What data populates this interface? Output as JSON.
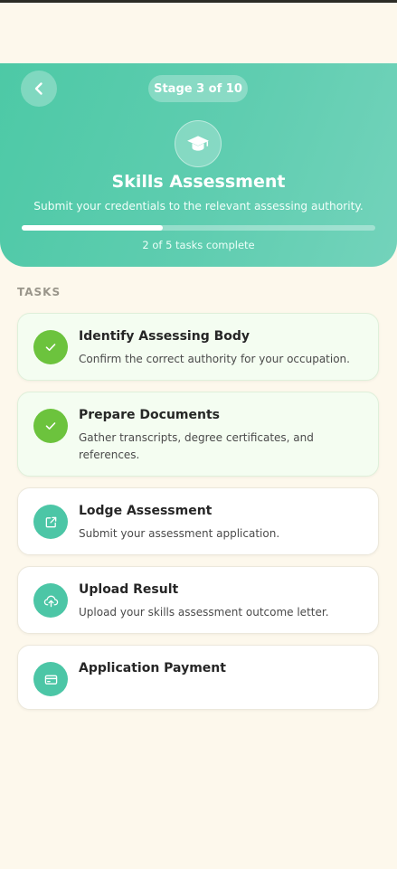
{
  "header": {
    "stage_label": "Stage 3 of 10",
    "title": "Skills Assessment",
    "subtitle": "Submit your credentials to the relevant assessing authority.",
    "progress_text": "2 of 5 tasks complete",
    "progress_fraction": 0.4,
    "icon": "graduation-cap-icon"
  },
  "tasks_section": {
    "label": "TASKS",
    "items": [
      {
        "title": "Identify Assessing Body",
        "description": "Confirm the correct authority for your occupation.",
        "status": "complete",
        "icon": "check-icon"
      },
      {
        "title": "Prepare Documents",
        "description": "Gather transcripts, degree certificates, and references.",
        "status": "complete",
        "icon": "check-icon"
      },
      {
        "title": "Lodge Assessment",
        "description": "Submit your assessment application.",
        "status": "pending",
        "icon": "external-link-icon"
      },
      {
        "title": "Upload Result",
        "description": "Upload your skills assessment outcome letter.",
        "status": "pending",
        "icon": "cloud-upload-icon"
      },
      {
        "title": "Application Payment",
        "description": "",
        "status": "pending",
        "icon": "credit-card-icon"
      }
    ]
  },
  "colors": {
    "header_teal": "#4dc9a6",
    "complete_green": "#6cc33d",
    "pending_teal": "#4cc6a6",
    "background": "#fdf8ec"
  }
}
